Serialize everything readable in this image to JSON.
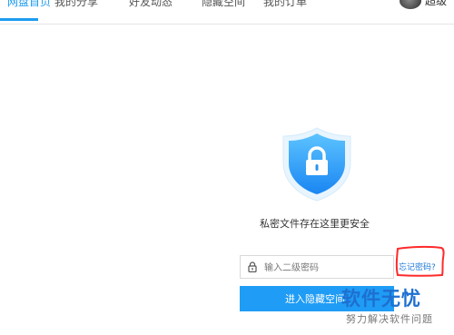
{
  "nav": {
    "tabs": [
      {
        "label": "网盘首页"
      },
      {
        "label": "我的分享"
      },
      {
        "label": "好友动态"
      },
      {
        "label": "隐藏空间"
      },
      {
        "label": "我的订单"
      }
    ],
    "username": "超级"
  },
  "main": {
    "tagline": "私密文件存在这里更安全",
    "password_placeholder": "输入二级密码",
    "forgot_label": "忘记密码?",
    "enter_label": "进入隐藏空间"
  },
  "watermark": {
    "title": "软件无忧",
    "subtitle": "努力解决软件问题"
  },
  "colors": {
    "accent": "#1e9bf0",
    "annotation": "#ff2a2a"
  }
}
